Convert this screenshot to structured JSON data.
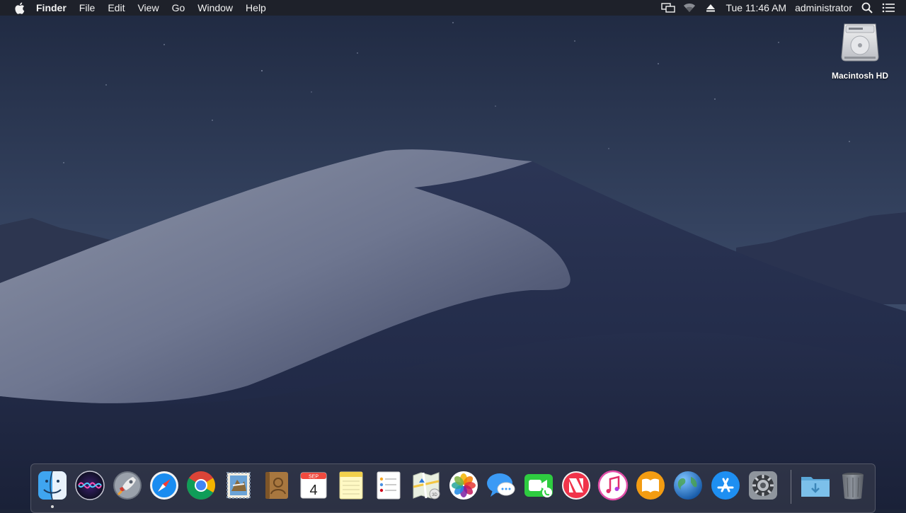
{
  "menubar": {
    "app_name": "Finder",
    "menus": [
      "File",
      "Edit",
      "View",
      "Go",
      "Window",
      "Help"
    ],
    "clock": "Tue 11:46 AM",
    "user": "administrator",
    "status_icons": [
      "display-mirroring-icon",
      "wifi-icon",
      "eject-icon",
      "spotlight-icon",
      "notification-center-icon"
    ]
  },
  "desktop": {
    "icons": [
      {
        "label": "Macintosh HD",
        "icon": "hard-drive-icon"
      }
    ]
  },
  "dock": {
    "apps": [
      {
        "name": "Finder",
        "icon": "finder-icon",
        "running": true
      },
      {
        "name": "Siri",
        "icon": "siri-icon"
      },
      {
        "name": "Launchpad",
        "icon": "launchpad-icon"
      },
      {
        "name": "Safari",
        "icon": "safari-icon"
      },
      {
        "name": "Google Chrome",
        "icon": "chrome-icon"
      },
      {
        "name": "Mail",
        "icon": "mail-icon"
      },
      {
        "name": "Contacts",
        "icon": "contacts-icon"
      },
      {
        "name": "Calendar",
        "icon": "calendar-icon",
        "month": "SEP",
        "day": "4"
      },
      {
        "name": "Notes",
        "icon": "notes-icon"
      },
      {
        "name": "Reminders",
        "icon": "reminders-icon"
      },
      {
        "name": "Maps",
        "icon": "maps-icon"
      },
      {
        "name": "Photos",
        "icon": "photos-icon"
      },
      {
        "name": "Messages",
        "icon": "messages-icon"
      },
      {
        "name": "FaceTime",
        "icon": "facetime-icon"
      },
      {
        "name": "News",
        "icon": "news-icon"
      },
      {
        "name": "iTunes",
        "icon": "itunes-icon"
      },
      {
        "name": "iBooks",
        "icon": "books-icon"
      },
      {
        "name": "Network",
        "icon": "globe-icon"
      },
      {
        "name": "App Store",
        "icon": "app-store-icon"
      },
      {
        "name": "System Preferences",
        "icon": "system-preferences-icon"
      },
      {
        "name": "Downloads",
        "icon": "downloads-folder-icon"
      },
      {
        "name": "Trash",
        "icon": "trash-icon"
      }
    ]
  }
}
